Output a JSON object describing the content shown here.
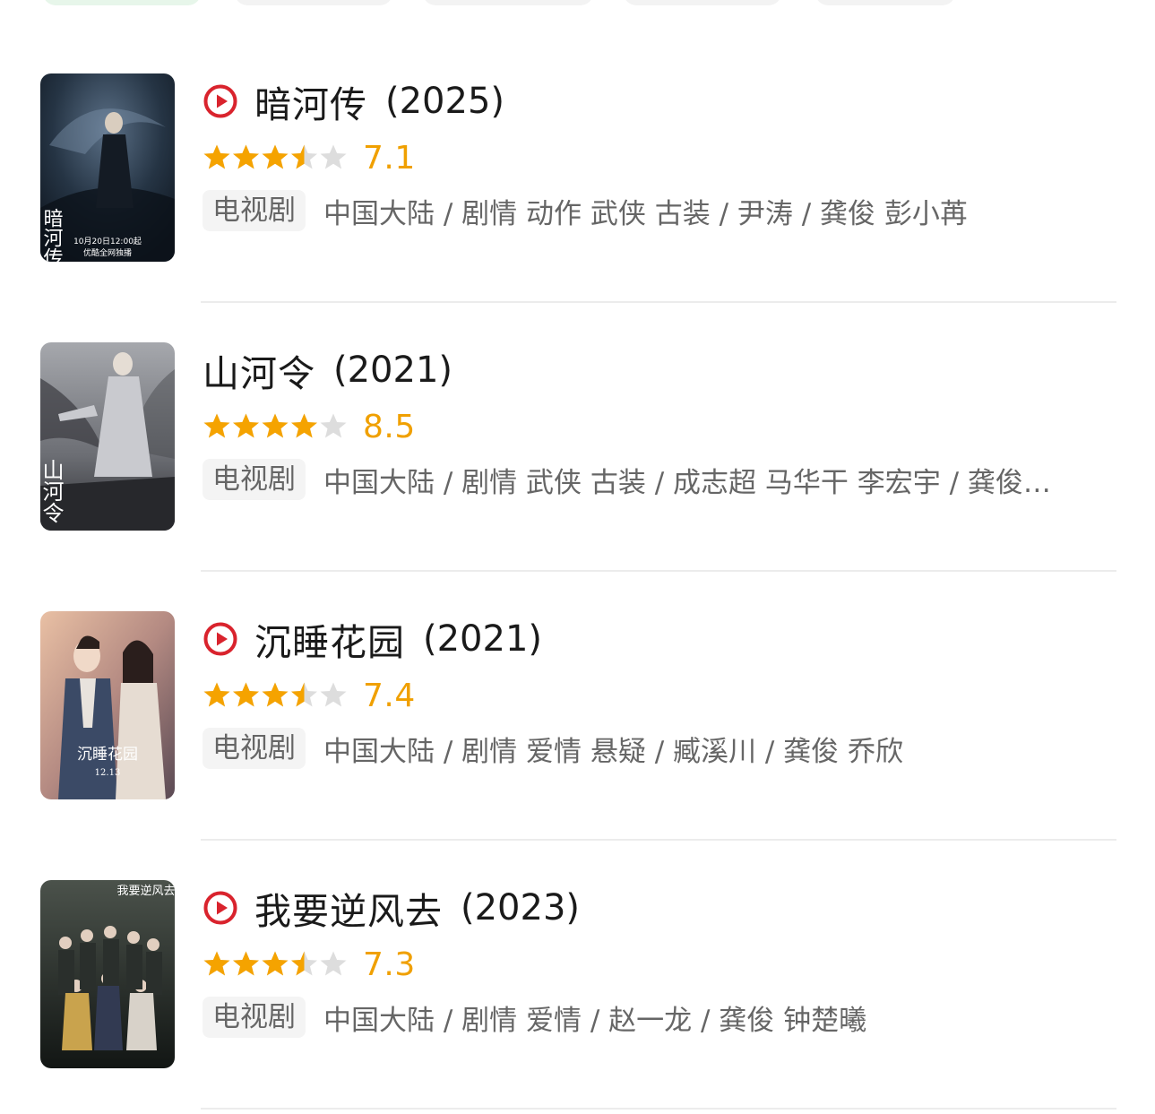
{
  "colors": {
    "star": "#f5a300",
    "star_empty": "#dddddd",
    "score": "#f0a000",
    "play": "#d9232d",
    "text": "#1a1a1a",
    "meta": "#666666"
  },
  "items": [
    {
      "title": "暗河传",
      "year": "(2025)",
      "has_play": true,
      "stars_filled": 3.5,
      "score": "7.1",
      "tag": "电视剧",
      "meta": "中国大陆 / 剧情 动作 武侠 古装 / 尹涛 / 龚俊 彭小苒",
      "poster_text": "暗河传",
      "poster_sub1": "10月20日12:00起",
      "poster_sub2": "优酷全网独播",
      "poster_colors": [
        "#1b2736",
        "#3a4d63"
      ]
    },
    {
      "title": "山河令",
      "year": "(2021)",
      "has_play": false,
      "stars_filled": 4,
      "score": "8.5",
      "tag": "电视剧",
      "meta": "中国大陆 / 剧情 武侠 古装 / 成志超 马华干 李宏宇 / 龚俊…",
      "poster_text": "山河令",
      "poster_colors": [
        "#8a8c91",
        "#3c3d42"
      ]
    },
    {
      "title": "沉睡花园",
      "year": "(2021)",
      "has_play": true,
      "stars_filled": 3.5,
      "score": "7.4",
      "tag": "电视剧",
      "meta": "中国大陆 / 剧情 爱情 悬疑 / 臧溪川 / 龚俊 乔欣",
      "poster_text": "沉睡花园",
      "poster_sub1": "12.13",
      "poster_colors": [
        "#d9a58b",
        "#6d5a63"
      ]
    },
    {
      "title": "我要逆风去",
      "year": "(2023)",
      "has_play": true,
      "stars_filled": 3.5,
      "score": "7.3",
      "tag": "电视剧",
      "meta": "中国大陆 / 剧情 爱情 / 赵一龙 / 龚俊 钟楚曦",
      "poster_text": "我要逆风去",
      "poster_colors": [
        "#3a3f3a",
        "#141816"
      ]
    }
  ]
}
